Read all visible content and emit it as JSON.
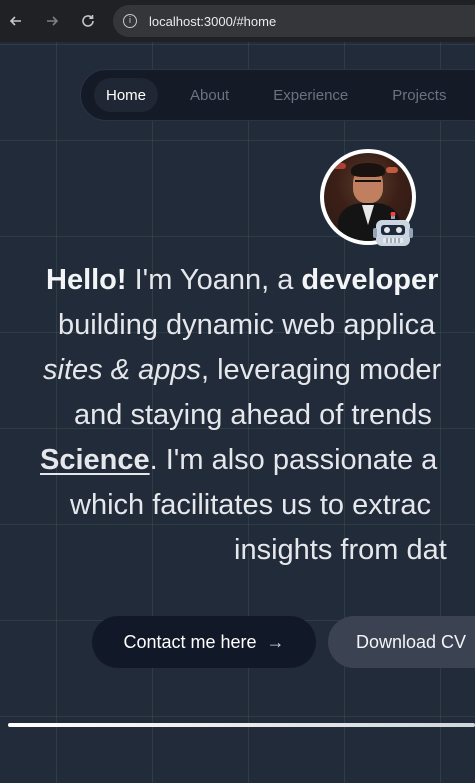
{
  "browser": {
    "url": "localhost:3000/#home",
    "back_icon": "arrow-left-icon",
    "forward_icon": "arrow-right-icon",
    "reload_icon": "reload-icon",
    "info_icon": "info-icon"
  },
  "nav": {
    "items": [
      {
        "label": "Home",
        "active": true
      },
      {
        "label": "About",
        "active": false
      },
      {
        "label": "Experience",
        "active": false
      },
      {
        "label": "Projects",
        "active": false
      }
    ]
  },
  "hero": {
    "avatar_badge": "robot-icon",
    "line1": {
      "hello": "Hello!",
      "intro": " I'm Yoann, a ",
      "role": "developer"
    },
    "line2": "building dynamic web applica",
    "line3": {
      "sites": "sites & apps",
      "rest": ", leveraging moder"
    },
    "line4": "and staying ahead of trends",
    "line5": {
      "science": "Science",
      "rest": ". I'm also passionate a"
    },
    "line6": "which facilitates us to extrac",
    "line7": "insights from dat"
  },
  "actions": {
    "contact_label": "Contact me here",
    "contact_arrow": "→",
    "cv_label": "Download CV"
  },
  "scroll_progress": 1.0,
  "colors": {
    "background": "#222b3a",
    "navbar": "#141a26",
    "button_dark": "#111827",
    "button_secondary": "#3b4352"
  }
}
